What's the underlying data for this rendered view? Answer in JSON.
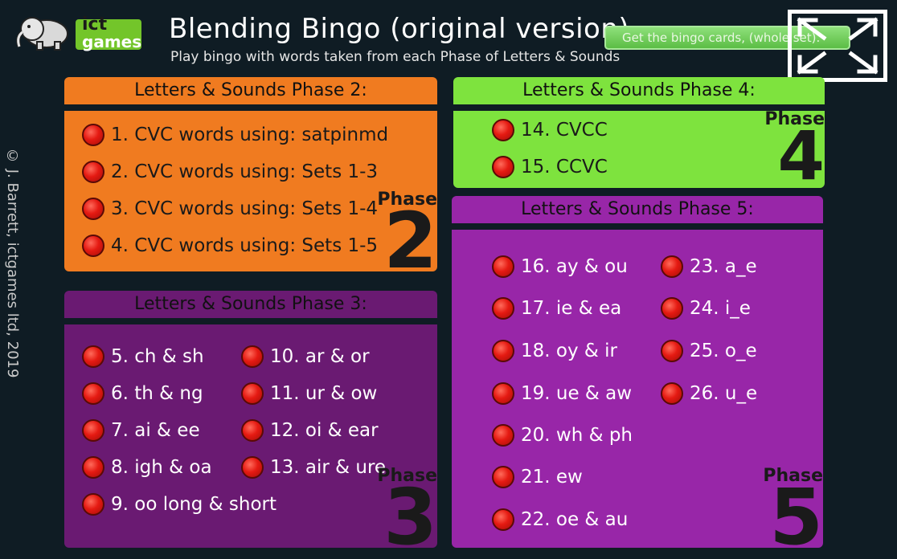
{
  "header": {
    "logo": {
      "ict": "ict",
      "games": "games"
    },
    "title": "Blending Bingo  (original version)",
    "subtitle": "Play bingo with words taken from each Phase of Letters & Sounds",
    "cards_button": "Get the bingo cards, (whole set)."
  },
  "copyright": "© J. Barrett, ictgames ltd, 2019",
  "colors": {
    "background": "#0f1c24",
    "phase2": "#f07b20",
    "phase3": "#6a1a72",
    "phase4": "#7ee33e",
    "phase5": "#9826a8",
    "dot": "#e51a12"
  },
  "phase2": {
    "heading": "Letters & Sounds Phase 2:",
    "badge_word": "Phase",
    "badge_num": "2",
    "items": [
      "1.  CVC words using: satpinmd",
      "2.  CVC words using: Sets 1-3",
      "3.  CVC words using: Sets 1-4",
      "4.  CVC words using: Sets 1-5"
    ]
  },
  "phase3": {
    "heading": "Letters & Sounds Phase 3:",
    "badge_word": "Phase",
    "badge_num": "3",
    "items": [
      "5.  ch & sh",
      "6.  th & ng",
      "7.  ai & ee",
      "8.  igh & oa",
      "9.  oo long & short",
      "10.  ar & or",
      "11.  ur & ow",
      "12.  oi & ear",
      "13.  air & ure"
    ]
  },
  "phase4": {
    "heading": "Letters & Sounds Phase 4:",
    "badge_word": "Phase",
    "badge_num": "4",
    "items": [
      "14.  CVCC",
      "15.  CCVC"
    ]
  },
  "phase5": {
    "heading": "Letters & Sounds Phase 5:",
    "badge_word": "Phase",
    "badge_num": "5",
    "items": [
      "16.  ay & ou",
      "17.  ie & ea",
      "18.  oy & ir",
      "19.  ue & aw",
      "20.  wh & ph",
      "21.  ew",
      "22.  oe & au",
      "23.  a_e",
      "24.  i_e",
      "25.  o_e",
      "26.  u_e"
    ]
  },
  "icons": {
    "fullscreen": "fullscreen-icon",
    "bingo_dot": "red-button-icon",
    "logo": "elephant-icon"
  }
}
